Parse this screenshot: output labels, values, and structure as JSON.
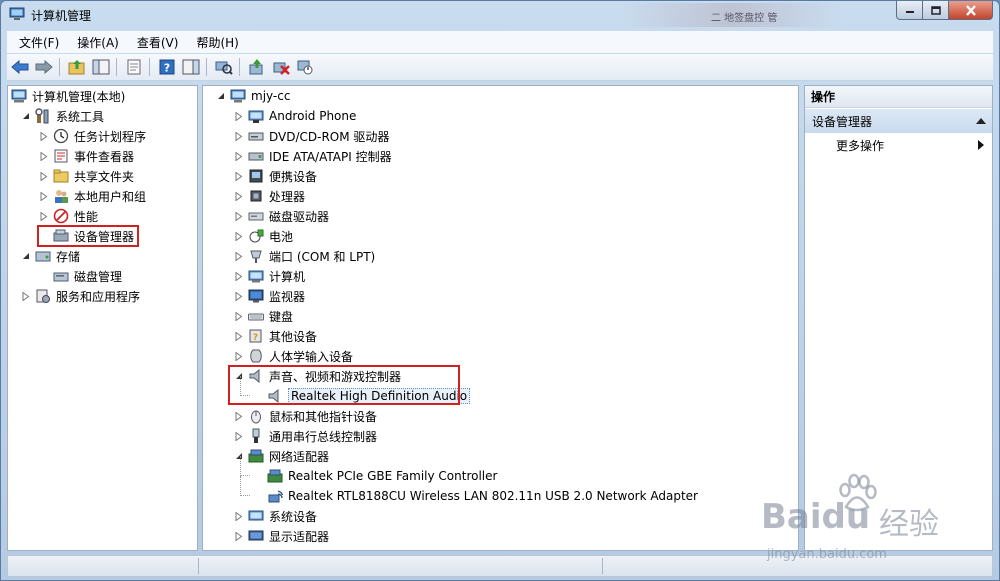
{
  "window": {
    "title": "计算机管理",
    "blurred_title_text": "二 地签盘控 管"
  },
  "menu": [
    "文件(F)",
    "操作(A)",
    "查看(V)",
    "帮助(H)"
  ],
  "left_tree": [
    {
      "label": "计算机管理(本地)",
      "level": 0,
      "expander": "",
      "icon": "computer-management-icon"
    },
    {
      "label": "系统工具",
      "level": 1,
      "expander": "expanded",
      "icon": "tools-icon"
    },
    {
      "label": "任务计划程序",
      "level": 2,
      "expander": "collapsed",
      "icon": "clock-icon"
    },
    {
      "label": "事件查看器",
      "level": 2,
      "expander": "collapsed",
      "icon": "event-viewer-icon"
    },
    {
      "label": "共享文件夹",
      "level": 2,
      "expander": "collapsed",
      "icon": "shared-folder-icon"
    },
    {
      "label": "本地用户和组",
      "level": 2,
      "expander": "collapsed",
      "icon": "users-icon"
    },
    {
      "label": "性能",
      "level": 2,
      "expander": "collapsed",
      "icon": "performance-icon"
    },
    {
      "label": "设备管理器",
      "level": 2,
      "expander": "",
      "icon": "device-manager-icon",
      "highlight": true
    },
    {
      "label": "存储",
      "level": 1,
      "expander": "expanded",
      "icon": "storage-icon"
    },
    {
      "label": "磁盘管理",
      "level": 2,
      "expander": "",
      "icon": "disk-management-icon"
    },
    {
      "label": "服务和应用程序",
      "level": 1,
      "expander": "collapsed",
      "icon": "services-icon"
    }
  ],
  "device_tree_root": "mjy-cc",
  "device_tree": [
    {
      "label": "Android Phone",
      "level": 1,
      "expander": "collapsed",
      "icon": "phone-icon"
    },
    {
      "label": "DVD/CD-ROM 驱动器",
      "level": 1,
      "expander": "collapsed",
      "icon": "dvd-icon"
    },
    {
      "label": "IDE ATA/ATAPI 控制器",
      "level": 1,
      "expander": "collapsed",
      "icon": "ide-icon"
    },
    {
      "label": "便携设备",
      "level": 1,
      "expander": "collapsed",
      "icon": "portable-device-icon"
    },
    {
      "label": "处理器",
      "level": 1,
      "expander": "collapsed",
      "icon": "cpu-icon"
    },
    {
      "label": "磁盘驱动器",
      "level": 1,
      "expander": "collapsed",
      "icon": "disk-drive-icon"
    },
    {
      "label": "电池",
      "level": 1,
      "expander": "collapsed",
      "icon": "battery-icon"
    },
    {
      "label": "端口 (COM 和 LPT)",
      "level": 1,
      "expander": "collapsed",
      "icon": "port-icon"
    },
    {
      "label": "计算机",
      "level": 1,
      "expander": "collapsed",
      "icon": "computer-icon"
    },
    {
      "label": "监视器",
      "level": 1,
      "expander": "collapsed",
      "icon": "monitor-icon"
    },
    {
      "label": "键盘",
      "level": 1,
      "expander": "collapsed",
      "icon": "keyboard-icon"
    },
    {
      "label": "其他设备",
      "level": 1,
      "expander": "collapsed",
      "icon": "other-device-icon"
    },
    {
      "label": "人体学输入设备",
      "level": 1,
      "expander": "collapsed",
      "icon": "hid-icon"
    },
    {
      "label": "声音、视频和游戏控制器",
      "level": 1,
      "expander": "expanded",
      "icon": "speaker-icon",
      "highlight_group_start": true
    },
    {
      "label": "Realtek High Definition Audio",
      "level": 2,
      "expander": "",
      "icon": "speaker-icon",
      "highlight_group_end": true,
      "selected": true
    },
    {
      "label": "鼠标和其他指针设备",
      "level": 1,
      "expander": "collapsed",
      "icon": "mouse-icon"
    },
    {
      "label": "通用串行总线控制器",
      "level": 1,
      "expander": "collapsed",
      "icon": "usb-icon"
    },
    {
      "label": "网络适配器",
      "level": 1,
      "expander": "expanded",
      "icon": "network-adapter-icon"
    },
    {
      "label": "Realtek PCIe GBE Family Controller",
      "level": 2,
      "expander": "",
      "icon": "network-adapter-icon"
    },
    {
      "label": "Realtek RTL8188CU Wireless LAN 802.11n USB 2.0 Network Adapter",
      "level": 2,
      "expander": "",
      "icon": "wireless-adapter-icon"
    },
    {
      "label": "系统设备",
      "level": 1,
      "expander": "collapsed",
      "icon": "system-device-icon"
    },
    {
      "label": "显示适配器",
      "level": 1,
      "expander": "collapsed",
      "icon": "display-adapter-icon"
    }
  ],
  "actions": {
    "header": "操作",
    "section": "设备管理器",
    "more": "更多操作"
  },
  "watermark": {
    "brand": "Baidu",
    "brand_cn": "经验",
    "url": "jingyan.baidu.com"
  },
  "colors": {
    "highlight_red": "#d21f1f",
    "title_bar": "#c9dcef",
    "action_section": "#c9dbef"
  }
}
